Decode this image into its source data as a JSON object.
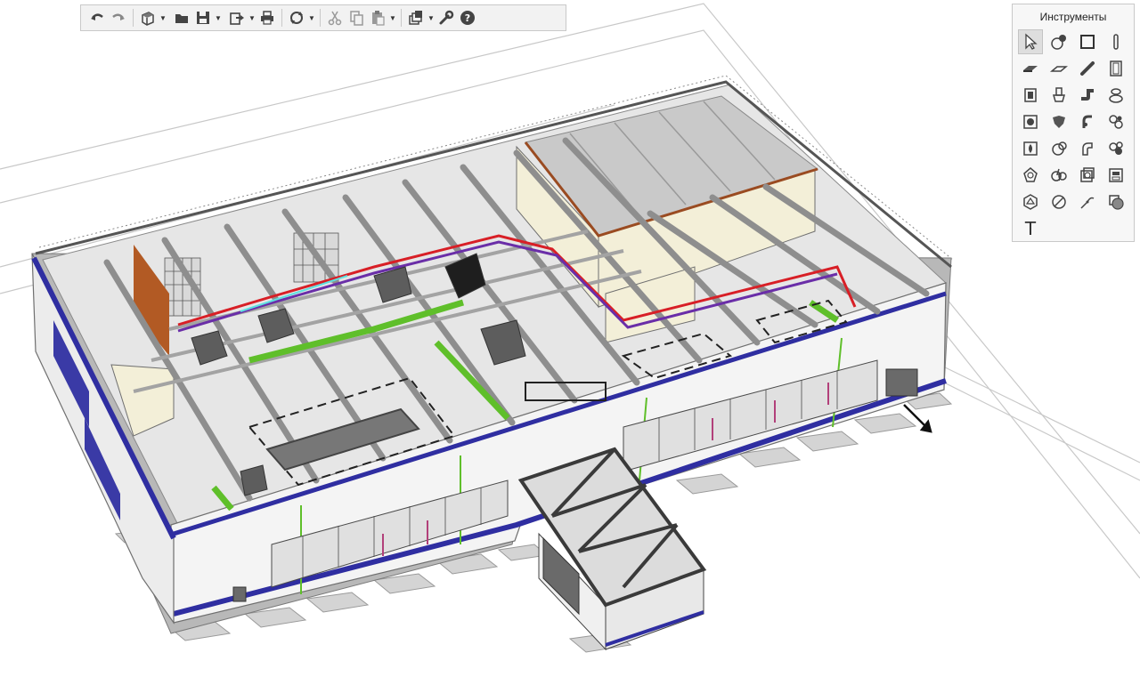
{
  "app": {
    "colors": {
      "toolbar_bg": "#f2f2f2",
      "panel_bg": "#f7f7f7",
      "facade_stripe": "#2f2ea1",
      "pipe_red": "#d81f26",
      "pipe_purple": "#6a2ea8",
      "pipe_cyan": "#5de0e0",
      "duct_green": "#5fbf2a",
      "truss_brown": "#9a4b21",
      "icon": "#444444"
    }
  },
  "toolbar": {
    "buttons": [
      {
        "name": "undo-icon"
      },
      {
        "name": "redo-icon"
      },
      {
        "name": "3d-view-icon",
        "has_dropdown": true
      },
      {
        "name": "open-folder-icon"
      },
      {
        "name": "save-icon",
        "has_dropdown": true
      },
      {
        "name": "export-icon",
        "has_dropdown": true
      },
      {
        "name": "print-icon"
      },
      {
        "name": "sync-icon",
        "has_dropdown": true
      },
      {
        "name": "cut-icon"
      },
      {
        "name": "copy-icon"
      },
      {
        "name": "paste-icon",
        "has_dropdown": true
      },
      {
        "name": "layers-icon",
        "has_dropdown": true
      },
      {
        "name": "settings-wrench-icon"
      },
      {
        "name": "help-icon"
      }
    ]
  },
  "tools_panel": {
    "title": "Инструменты",
    "active_tool": "select-cursor-icon",
    "tools": [
      "select-cursor-icon",
      "place-object-icon",
      "wall-icon",
      "column-icon",
      "slab-icon",
      "floor-icon",
      "beam-icon",
      "door-icon",
      "window-icon",
      "fixture-icon",
      "pipe-elbow-icon",
      "sanitary-icon",
      "equipment-icon",
      "pump-icon",
      "pipe-fitting-icon",
      "valve-group-icon",
      "hvac-unit-icon",
      "fan-icon",
      "duct-fitting-icon",
      "duct-accessory-icon",
      "lighting-icon",
      "electrical-device-icon",
      "air-terminal-icon",
      "panel-board-icon",
      "structural-node-icon",
      "measure-icon",
      "annotation-icon",
      "material-icon",
      "text-icon"
    ],
    "text_tool_glyph": "T"
  }
}
